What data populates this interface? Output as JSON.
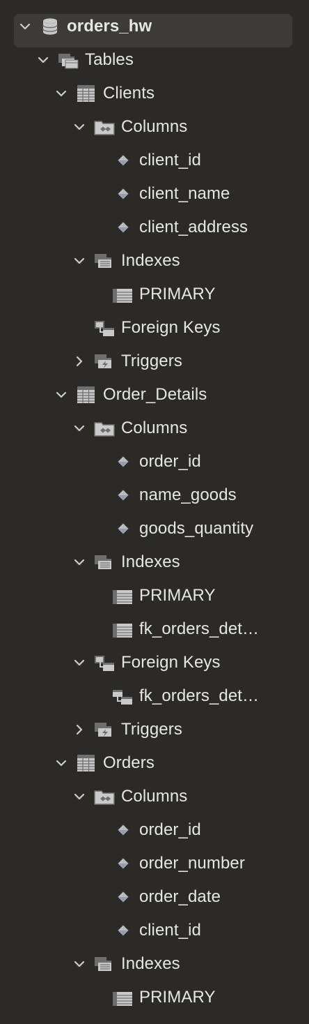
{
  "colors": {
    "background": "#2b2a27",
    "selection": "#3c3b38",
    "text": "#e6e6e6",
    "icon_light": "#c9c9c9",
    "icon_dark": "#6e6e6e"
  },
  "tree": [
    {
      "id": "db",
      "label": "orders_hw",
      "level": 0,
      "icon": "database-icon",
      "chevron": "down",
      "bold": true,
      "selected": true
    },
    {
      "id": "tables",
      "label": "Tables",
      "level": 1,
      "icon": "folder-tables-icon",
      "chevron": "down"
    },
    {
      "id": "t-clients",
      "label": "Clients",
      "level": 2,
      "icon": "table-icon",
      "chevron": "down"
    },
    {
      "id": "clients-columns",
      "label": "Columns",
      "level": 3,
      "icon": "columns-folder-icon",
      "chevron": "down"
    },
    {
      "id": "clients-col-client-id",
      "label": "client_id",
      "level": 4,
      "icon": "column-diamond-icon"
    },
    {
      "id": "clients-col-client-name",
      "label": "client_name",
      "level": 4,
      "icon": "column-diamond-icon"
    },
    {
      "id": "clients-col-client-address",
      "label": "client_address",
      "level": 4,
      "icon": "column-diamond-icon"
    },
    {
      "id": "clients-indexes",
      "label": "Indexes",
      "level": 3,
      "icon": "indexes-folder-icon",
      "chevron": "down"
    },
    {
      "id": "clients-index-primary",
      "label": "PRIMARY",
      "level": 4,
      "icon": "index-icon"
    },
    {
      "id": "clients-foreign-keys",
      "label": "Foreign Keys",
      "level": 3,
      "icon": "foreign-keys-folder-icon"
    },
    {
      "id": "clients-triggers",
      "label": "Triggers",
      "level": 3,
      "icon": "triggers-folder-icon",
      "chevron": "right"
    },
    {
      "id": "t-order-details",
      "label": "Order_Details",
      "level": 2,
      "icon": "table-icon",
      "chevron": "down"
    },
    {
      "id": "od-columns",
      "label": "Columns",
      "level": 3,
      "icon": "columns-folder-icon",
      "chevron": "down"
    },
    {
      "id": "od-col-order-id",
      "label": "order_id",
      "level": 4,
      "icon": "column-diamond-icon"
    },
    {
      "id": "od-col-name-goods",
      "label": "name_goods",
      "level": 4,
      "icon": "column-diamond-icon"
    },
    {
      "id": "od-col-goods-quantity",
      "label": "goods_quantity",
      "level": 4,
      "icon": "column-diamond-icon"
    },
    {
      "id": "od-indexes",
      "label": "Indexes",
      "level": 3,
      "icon": "indexes-folder-icon",
      "chevron": "down"
    },
    {
      "id": "od-index-primary",
      "label": "PRIMARY",
      "level": 4,
      "icon": "index-icon"
    },
    {
      "id": "od-index-fk",
      "label": "fk_orders_det…",
      "level": 4,
      "icon": "index-icon"
    },
    {
      "id": "od-foreign-keys",
      "label": "Foreign Keys",
      "level": 3,
      "icon": "foreign-keys-folder-icon",
      "chevron": "down"
    },
    {
      "id": "od-fk-item",
      "label": "fk_orders_det…",
      "level": 4,
      "icon": "foreign-key-icon"
    },
    {
      "id": "od-triggers",
      "label": "Triggers",
      "level": 3,
      "icon": "triggers-folder-icon",
      "chevron": "right"
    },
    {
      "id": "t-orders",
      "label": "Orders",
      "level": 2,
      "icon": "table-icon",
      "chevron": "down"
    },
    {
      "id": "orders-columns",
      "label": "Columns",
      "level": 3,
      "icon": "columns-folder-icon",
      "chevron": "down"
    },
    {
      "id": "orders-col-order-id",
      "label": "order_id",
      "level": 4,
      "icon": "column-diamond-icon"
    },
    {
      "id": "orders-col-order-number",
      "label": "order_number",
      "level": 4,
      "icon": "column-diamond-icon"
    },
    {
      "id": "orders-col-order-date",
      "label": "order_date",
      "level": 4,
      "icon": "column-diamond-icon"
    },
    {
      "id": "orders-col-client-id",
      "label": "client_id",
      "level": 4,
      "icon": "column-diamond-icon"
    },
    {
      "id": "orders-indexes",
      "label": "Indexes",
      "level": 3,
      "icon": "indexes-folder-icon",
      "chevron": "down"
    },
    {
      "id": "orders-index-primary",
      "label": "PRIMARY",
      "level": 4,
      "icon": "index-icon"
    }
  ]
}
